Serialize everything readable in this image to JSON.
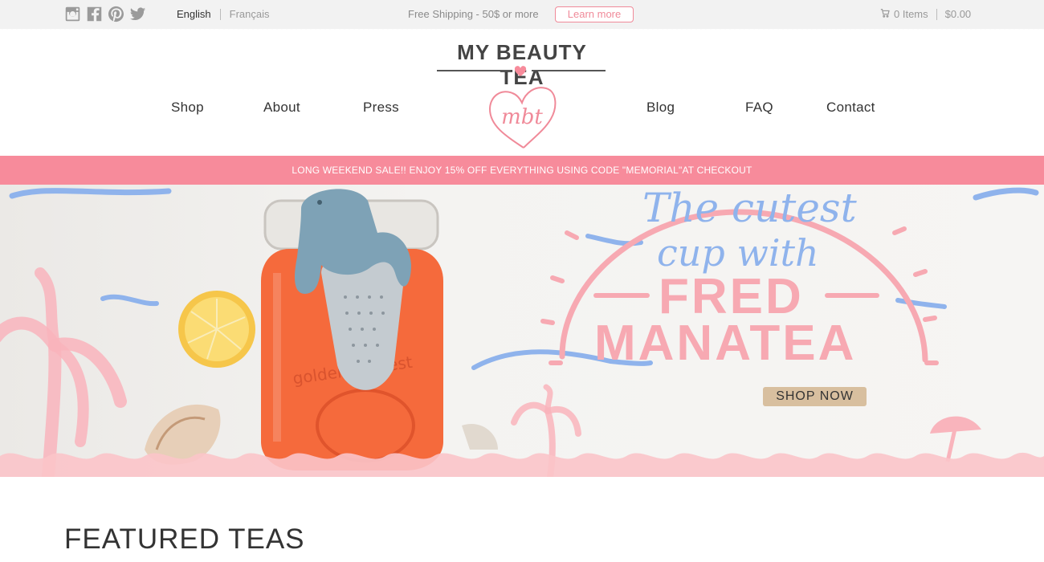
{
  "topbar": {
    "social_icons": [
      "instagram-icon",
      "facebook-icon",
      "pinterest-icon",
      "twitter-icon"
    ],
    "languages": {
      "active": "English",
      "inactive": "Français"
    },
    "shipping_text": "Free Shipping - 50$ or more",
    "learn_more": "Learn more",
    "cart": {
      "items": "0 Items",
      "total": "$0.00",
      "icon": "cart-icon"
    }
  },
  "header": {
    "logo_text": "MY BEAUTY TEA",
    "logo_monogram": "mbt",
    "nav": [
      "Shop",
      "About",
      "Press",
      "Blog",
      "FAQ",
      "Contact"
    ]
  },
  "promo": "LONG WEEKEND SALE!! ENJOY 15% OFF EVERYTHING USING CODE \"MEMORIAL\"AT CHECKOUT",
  "hero": {
    "script_line1": "The cutest",
    "script_line2": "cup with",
    "big_line1": "FRED",
    "big_line2": "MANATEA",
    "jar_text": "golden harvest",
    "cta": "SHOP NOW"
  },
  "featured_title": "FEATURED TEAS",
  "colors": {
    "accent": "#f78b9b",
    "script_blue": "#8fb3ec",
    "pink_text": "#f7a9b2",
    "cta_bg": "#d8bf9f"
  }
}
